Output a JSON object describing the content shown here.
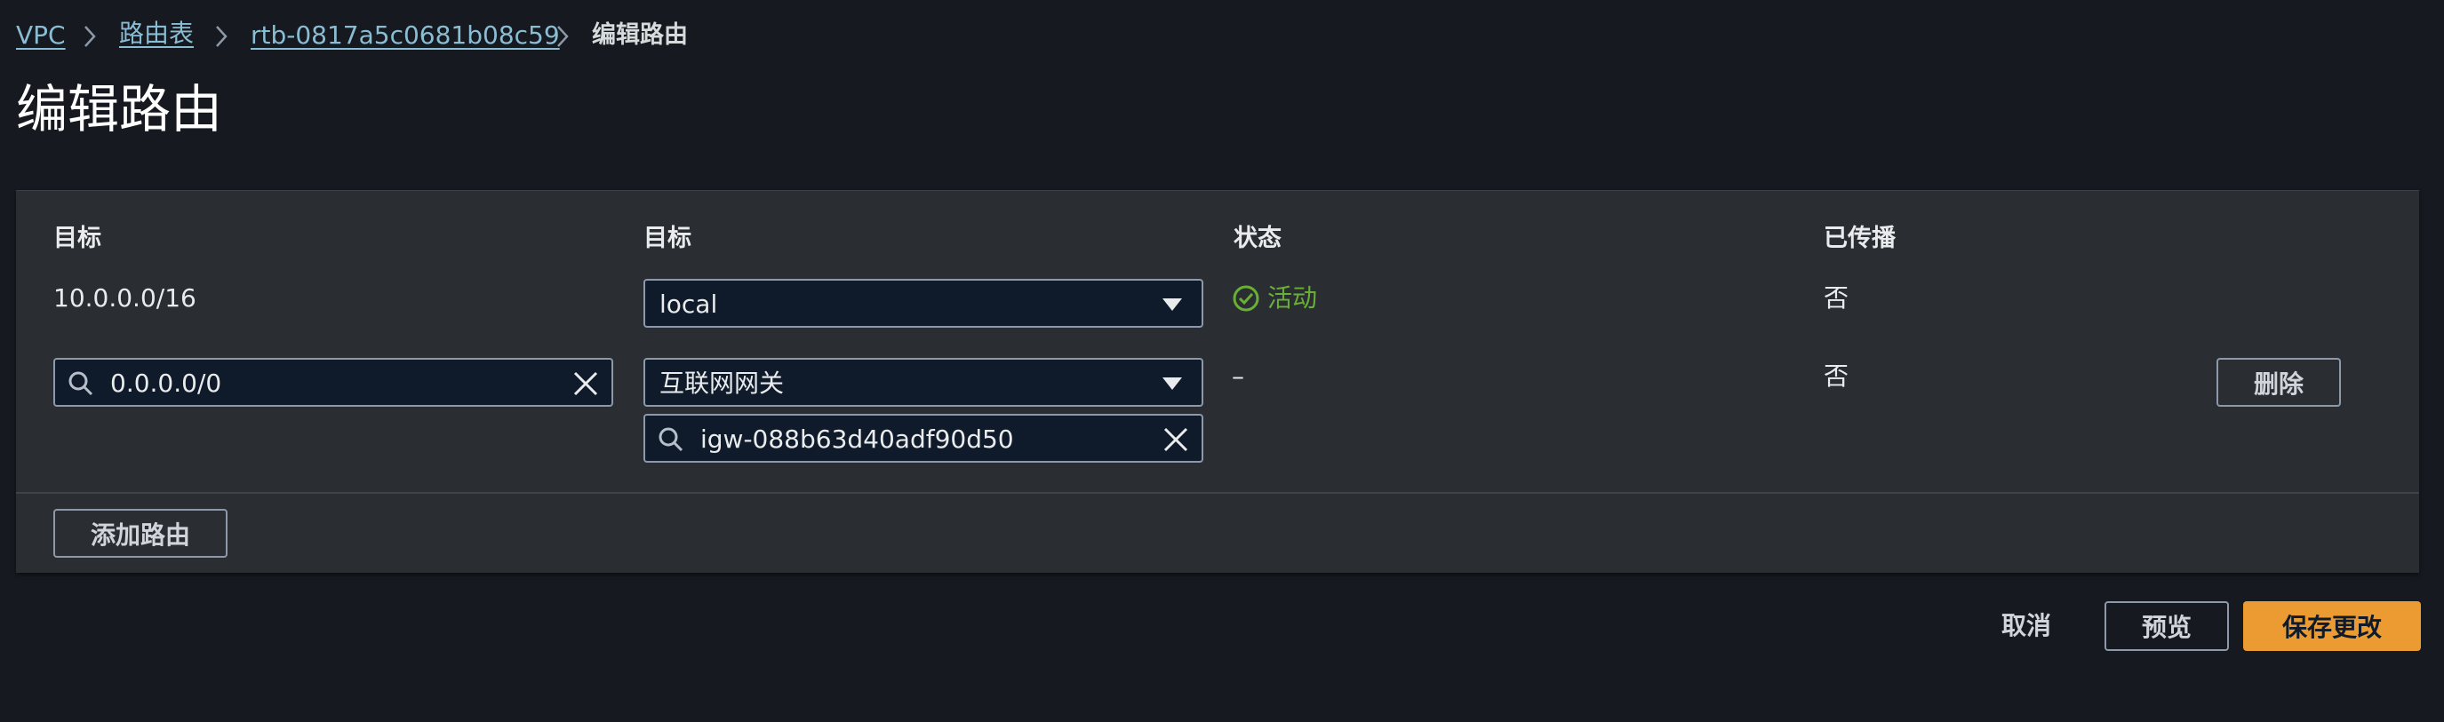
{
  "breadcrumb": {
    "items": [
      "VPC",
      "路由表",
      "rtb-0817a5c0681b08c59"
    ],
    "current": "编辑路由"
  },
  "page": {
    "title": "编辑路由"
  },
  "table": {
    "headers": {
      "destination": "目标",
      "target": "目标",
      "status": "状态",
      "propagated": "已传播"
    },
    "rows": [
      {
        "destination": "10.0.0.0/16",
        "target_select": "local",
        "status": "活动",
        "propagated": "否"
      },
      {
        "destination_input": "0.0.0.0/0",
        "target_select": "互联网网关",
        "target_search": "igw-088b63d40adf90d50",
        "status": "–",
        "propagated": "否",
        "remove_label": "删除"
      }
    ]
  },
  "actions": {
    "add_route": "添加路由",
    "cancel": "取消",
    "preview": "预览",
    "save": "保存更改"
  },
  "colors": {
    "background": "#16191f",
    "panel": "#2a2e33",
    "link": "#89bdd3",
    "primary": "#ec9b32",
    "success": "#6aaf35"
  },
  "icons": [
    "chevron-right-icon",
    "search-icon",
    "clear-icon",
    "caret-down-icon",
    "status-check-icon"
  ]
}
